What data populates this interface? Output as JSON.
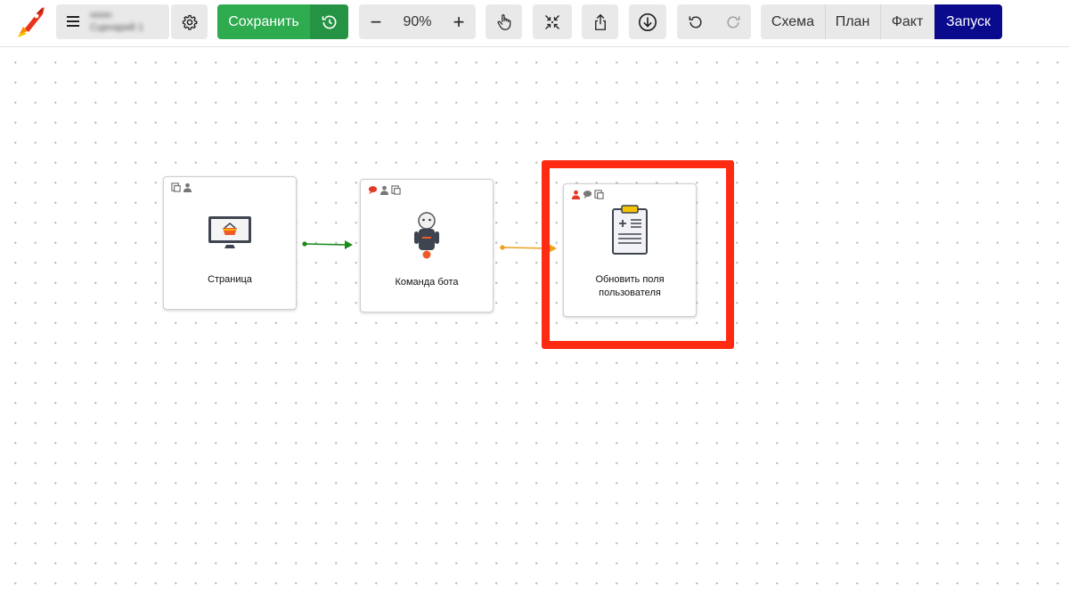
{
  "toolbar": {
    "scenario_name": "ноон",
    "scenario_sub": "Сценарий 1",
    "save_label": "Сохранить",
    "zoom": "90%",
    "zoom_out": "−",
    "zoom_in": "+",
    "views": [
      "Схема",
      "План",
      "Факт"
    ],
    "run_label": "Запуск",
    "colors": {
      "save": "#2eaa4f",
      "save_dark": "#249343",
      "run": "#0a0a8c",
      "grey": "#e9e9e9"
    }
  },
  "nodes": [
    {
      "label": "Страница",
      "icon": "monitor-basket-icon",
      "badges": [
        "form-icon",
        "user-icon"
      ]
    },
    {
      "label": "Команда бота",
      "icon": "robot-icon",
      "badges": [
        "chat-icon",
        "user-icon",
        "form-icon"
      ]
    },
    {
      "label": "Обновить поля пользователя",
      "icon": "clipboard-icon",
      "badges": [
        "user-icon",
        "chat-icon",
        "form-icon"
      ]
    }
  ],
  "connections": [
    {
      "from": "Страница",
      "to": "Команда бота",
      "color": "#1a8a1a"
    },
    {
      "from": "Команда бота",
      "to": "Обновить поля пользователя",
      "color": "#f0a020"
    }
  ],
  "highlight": {
    "color": "#ff2a12"
  }
}
